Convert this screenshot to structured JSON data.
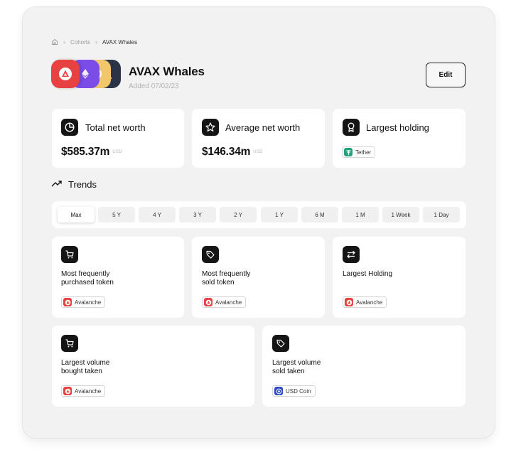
{
  "breadcrumb": {
    "parent": "Cohorts",
    "current": "AVAX Whales"
  },
  "header": {
    "title": "AVAX Whales",
    "added": "Added 07/02/23",
    "edit_label": "Edit"
  },
  "stats": [
    {
      "label": "Total net worth",
      "value": "$585.37m",
      "unit": "USD",
      "icon": "pie-chart-icon"
    },
    {
      "label": "Average net worth",
      "value": "$146.34m",
      "unit": "USD",
      "icon": "star-icon"
    },
    {
      "label": "Largest holding",
      "token": "Tether",
      "icon": "award-icon"
    }
  ],
  "trends": {
    "title": "Trends",
    "tabs": [
      "Max",
      "5 Y",
      "4 Y",
      "3 Y",
      "2 Y",
      "1 Y",
      "6 M",
      "1 M",
      "1 Week",
      "1 Day"
    ],
    "active_tab": "Max"
  },
  "metrics": [
    {
      "label_line1": "Most frequently",
      "label_line2": "purchased token",
      "token": "Avalanche",
      "icon": "cart-icon"
    },
    {
      "label_line1": "Most frequently",
      "label_line2": "sold token",
      "token": "Avalanche",
      "icon": "tag-icon"
    },
    {
      "label_line1": "Largest Holding",
      "label_line2": "",
      "token": "Avalanche",
      "icon": "swap-icon"
    },
    {
      "label_line1": "Largest volume",
      "label_line2": "bought taken",
      "token": "Avalanche",
      "icon": "cart-icon"
    },
    {
      "label_line1": "Largest volume",
      "label_line2": "sold taken",
      "token": "USD Coin",
      "icon": "tag-icon"
    }
  ],
  "colors": {
    "avalanche": "#e84142",
    "tether": "#26a17b",
    "usdc": "#2775ca",
    "dark": "#151515"
  }
}
